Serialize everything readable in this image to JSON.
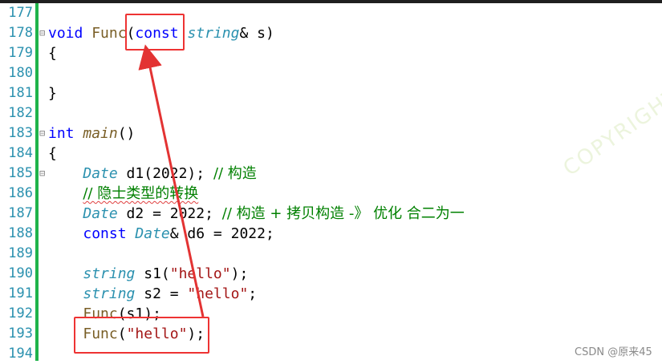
{
  "editor": {
    "lines": [
      {
        "num": "177",
        "fold": "",
        "html": ""
      },
      {
        "num": "178",
        "fold": "⊟",
        "parts": [
          [
            "kw",
            "void"
          ],
          [
            "nm",
            " "
          ],
          [
            "fn",
            "Func"
          ],
          [
            "nm",
            "("
          ],
          [
            "kw",
            "const"
          ],
          [
            "nm",
            " "
          ],
          [
            "ty",
            "string"
          ],
          [
            "nm",
            "& s)"
          ]
        ]
      },
      {
        "num": "179",
        "fold": "",
        "parts": [
          [
            "nm",
            "{"
          ]
        ]
      },
      {
        "num": "180",
        "fold": "",
        "parts": []
      },
      {
        "num": "181",
        "fold": "",
        "parts": [
          [
            "nm",
            "}"
          ]
        ]
      },
      {
        "num": "182",
        "fold": "",
        "parts": []
      },
      {
        "num": "183",
        "fold": "⊟",
        "parts": [
          [
            "kw",
            "int"
          ],
          [
            "nm",
            " "
          ],
          [
            "fn it",
            "main"
          ],
          [
            "nm",
            "()"
          ]
        ]
      },
      {
        "num": "184",
        "fold": "",
        "parts": [
          [
            "nm",
            "{"
          ]
        ]
      },
      {
        "num": "185",
        "fold": "⊟",
        "parts": [
          [
            "nm",
            "    "
          ],
          [
            "ty",
            "Date"
          ],
          [
            "nm",
            " d1(2022); "
          ],
          [
            "cm",
            "// 构造"
          ]
        ]
      },
      {
        "num": "186",
        "fold": "",
        "parts": [
          [
            "nm",
            "    "
          ],
          [
            "cm squig",
            "// 隐士类型的转换"
          ]
        ]
      },
      {
        "num": "187",
        "fold": "",
        "parts": [
          [
            "nm",
            "    "
          ],
          [
            "ty",
            "Date"
          ],
          [
            "nm",
            " d2 = 2022; "
          ],
          [
            "cm",
            "// 构造 + 拷贝构造 -》 优化 合二为一"
          ]
        ]
      },
      {
        "num": "188",
        "fold": "",
        "parts": [
          [
            "nm",
            "    "
          ],
          [
            "kw",
            "const"
          ],
          [
            "nm",
            " "
          ],
          [
            "ty",
            "Date"
          ],
          [
            "nm",
            "& d6 = 2022;"
          ]
        ]
      },
      {
        "num": "189",
        "fold": "",
        "parts": []
      },
      {
        "num": "190",
        "fold": "",
        "parts": [
          [
            "nm",
            "    "
          ],
          [
            "ty",
            "string"
          ],
          [
            "nm",
            " s1("
          ],
          [
            "str",
            "\"hello\""
          ],
          [
            "nm",
            ");"
          ]
        ]
      },
      {
        "num": "191",
        "fold": "",
        "parts": [
          [
            "nm",
            "    "
          ],
          [
            "ty",
            "string"
          ],
          [
            "nm",
            " s2 = "
          ],
          [
            "str",
            "\"hello\""
          ],
          [
            "nm",
            ";"
          ]
        ]
      },
      {
        "num": "192",
        "fold": "",
        "parts": [
          [
            "nm",
            "    "
          ],
          [
            "fn",
            "Func"
          ],
          [
            "nm",
            "(s1);"
          ]
        ]
      },
      {
        "num": "193",
        "fold": "",
        "parts": [
          [
            "nm",
            "    "
          ],
          [
            "fn",
            "Func"
          ],
          [
            "nm",
            "("
          ],
          [
            "str",
            "\"hello\""
          ],
          [
            "nm",
            ");"
          ]
        ]
      },
      {
        "num": "194",
        "fold": "",
        "parts": []
      }
    ]
  },
  "watermark": "COPYRIGHT",
  "footer": {
    "credit": "CSDN @原来45"
  },
  "colors": {
    "annotation": "#e33333",
    "gutter_bar": "#1fb34a",
    "line_number": "#2b91af"
  }
}
